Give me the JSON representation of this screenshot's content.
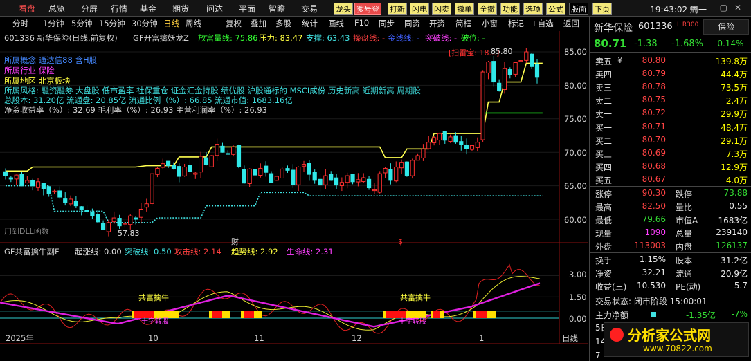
{
  "menu": {
    "items": [
      "看盘",
      "总览",
      "分屏",
      "行情",
      "基金",
      "期货",
      "问达",
      "平面",
      "智瞻",
      "交易"
    ],
    "toolbar": [
      "龙头",
      "爹号登",
      "打新",
      "闪电",
      "闪卖",
      "撤单",
      "全撤",
      "功能",
      "选项",
      "公式",
      "版面",
      "下页"
    ],
    "clock": "19:43:02 周一"
  },
  "timeframes": [
    "分时",
    "1分钟",
    "5分钟",
    "15分钟",
    "30分钟",
    "日线",
    "周线"
  ],
  "tools": [
    "复权",
    "叠加",
    "多股",
    "统计",
    "画线",
    "F10",
    "同步",
    "同资",
    "开资",
    "简框",
    "小窗",
    "标记",
    "+自选",
    "返回"
  ],
  "stock": {
    "code": "601336",
    "name": "新华保险",
    "header": "601336 新华保险(日线,前复权)",
    "indicator": "GF开富擒妖龙Z"
  },
  "main_legend": {
    "volume_label": "放富量线: 75.86",
    "pressure_label": "压力: 83.47",
    "support_label": "支撑: 63.43",
    "pan_label": "操盘线: -",
    "gold_label": "金线线: -",
    "breakout_label": "突破线: -",
    "break_label": "破位: -"
  },
  "info": {
    "concept": "所属概念 通达信88 含H股",
    "industry": "所属行业 保险",
    "region": "所属地区 北京板块",
    "style": "所属风格: 融资融券 大盘股 低市盈率 社保重仓 证金汇金持股 绩优股 沪股通标的 MSCI成份 历史新高 近期新高 周期股",
    "capital": "总股本: 31.20亿 流通盘: 20.85亿 流通比例（%）: 66.85 流通市值: 1683.16亿",
    "ratios": "净资收益率（%）: 32.69 毛利率（%）: 26.93 主营利润率（%）: 26.93"
  },
  "chart_marks": {
    "high": "85.80",
    "low": "57.83",
    "tag": "[扫雷宝: 18...]",
    "dll": "用到DLL函数",
    "cai": "财",
    "dollar": "$"
  },
  "price_axis": [
    "85.00",
    "80.00",
    "75.00",
    "70.00",
    "65.00",
    "60.00"
  ],
  "sub_axis": [
    "3.00",
    "1.50",
    "0.00"
  ],
  "sub_legend": {
    "name": "GF共富擒牛副F",
    "start": "起涨线: 0.00",
    "break": "突破线: 0.50",
    "attack": "攻击线: 2.14",
    "trend": "趋势线: 2.92",
    "life": "生命线: 2.31"
  },
  "sub_labels": {
    "gongfu1": "共富擒牛",
    "gongfu2": "共富擒牛",
    "shizhuan1": "十字转股",
    "shizhuan2": "十字转股"
  },
  "x_axis": {
    "labels": [
      "2025年",
      "10",
      "11",
      "12",
      "1"
    ],
    "period": "日线"
  },
  "chart_data": {
    "type": "candlestick",
    "closes": [
      66.5,
      66.0,
      66.6,
      65.2,
      65.8,
      65.0,
      65.6,
      64.5,
      63.8,
      64.2,
      63.3,
      62.5,
      63.0,
      62.0,
      61.5,
      61.2,
      60.5,
      59.6,
      58.5,
      59.5,
      60.2,
      59.0,
      59.4,
      60.5,
      60.0,
      61.5,
      62.3,
      66.8,
      67.6,
      68.3,
      68.0,
      67.5,
      66.4,
      67.8,
      67.1,
      66.9,
      69.4,
      68.2,
      69.5,
      71.2,
      70.0,
      69.8,
      70.8,
      67.8,
      65.4,
      67.5,
      66.6,
      67.6,
      67.0,
      65.5,
      66.4,
      67.5,
      67.3,
      65.2,
      67.8,
      68.2,
      66.7,
      65.8,
      65.1,
      66.5,
      65.8,
      65.1,
      65.5,
      66.5,
      65.6,
      65.9,
      66.2,
      64.7,
      64.4,
      66.8,
      67.6,
      65.8,
      67.8,
      68.5,
      66.5,
      68.8,
      69.5,
      70.5,
      71.5,
      72.2,
      72.8,
      71.8,
      72.3,
      71.5,
      71.2,
      70.5,
      71.0,
      71.5,
      82.0,
      83.5,
      80.5,
      79.2,
      82.5,
      81.6,
      83.4,
      83.7,
      85.0,
      82.8,
      81.2
    ],
    "high": 85.8,
    "low": 57.83,
    "ylim": [
      55.5,
      87.0
    ]
  },
  "right": {
    "title": "新华保险",
    "code": "601336",
    "badge": "L R300",
    "sector": "保险",
    "price": "80.71",
    "change": "-1.38",
    "pct": "-1.68%",
    "sector_pct": "-0.14%",
    "asks": [
      [
        "卖五",
        "¥",
        "80.80",
        "139.8万"
      ],
      [
        "卖四",
        "",
        "80.79",
        "44.4万"
      ],
      [
        "卖三",
        "",
        "80.78",
        "73.5万"
      ],
      [
        "卖二",
        "",
        "80.75",
        "2.4万"
      ],
      [
        "卖一",
        "",
        "80.72",
        "29.9万"
      ]
    ],
    "bids": [
      [
        "买一",
        "80.71",
        "48.4万"
      ],
      [
        "买二",
        "80.70",
        "29.1万"
      ],
      [
        "买三",
        "80.69",
        "7.3万"
      ],
      [
        "买四",
        "80.68",
        "12.9万"
      ],
      [
        "买五",
        "80.67",
        "4.0万"
      ]
    ],
    "stats1": [
      [
        "涨停",
        "90.30",
        "跌停",
        "73.88"
      ],
      [
        "最高",
        "82.50",
        "量比",
        "0.55"
      ],
      [
        "最低",
        "79.66",
        "市值A",
        "1683亿"
      ],
      [
        "现量",
        "1090",
        "总量",
        "239140"
      ],
      [
        "外盘",
        "113003",
        "内盘",
        "126137"
      ]
    ],
    "stats2": [
      [
        "换手",
        "1.15%",
        "股本",
        "31.2亿"
      ],
      [
        "净资",
        "32.21",
        "流通",
        "20.9亿"
      ],
      [
        "收益(三)",
        "10.530",
        "PE(动)",
        "5.7"
      ]
    ],
    "status": "交易状态: 闭市阶段 15:00:01",
    "netflow": "主力净额",
    "netflow_val": "-1.35亿",
    "netflow_pct": "-7%",
    "r5": "5日",
    "r14": "14",
    "r7": "7"
  },
  "watermark": {
    "text": "分析家公式网",
    "url": "www.70822.com"
  }
}
